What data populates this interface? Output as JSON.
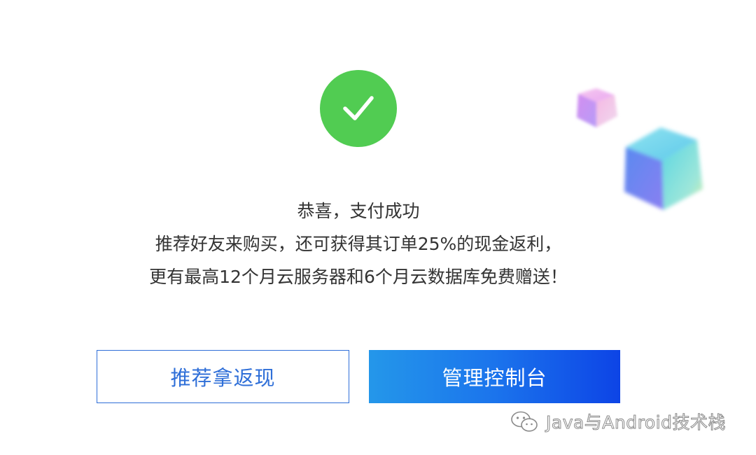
{
  "status": {
    "icon": "check-icon",
    "color": "#51cc52"
  },
  "message": {
    "title": "恭喜，支付成功",
    "line2": "推荐好友来购买，还可获得其订单25%的现金返利，",
    "line3": "更有最高12个月云服务器和6个月云数据库免费赠送！"
  },
  "actions": {
    "referral_label": "推荐拿返现",
    "console_label": "管理控制台",
    "accent_color": "#2f6fd8"
  },
  "decorations": {
    "small_cube": "pink-cube-decoration",
    "large_cube": "blue-cube-decoration"
  },
  "watermark": {
    "icon": "wechat-icon",
    "text": "Java与Android技术栈"
  }
}
